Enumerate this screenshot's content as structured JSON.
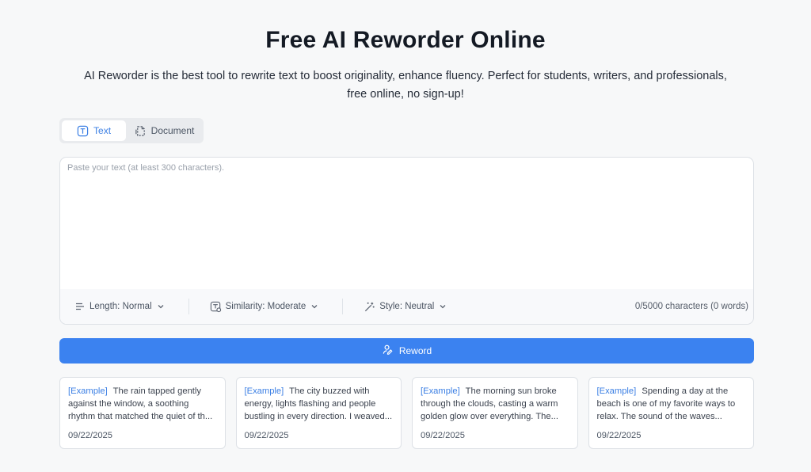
{
  "header": {
    "title": "Free AI Reworder Online",
    "subtitle": "AI Reworder is the best tool to rewrite text to boost originality, enhance fluency. Perfect for students, writers, and professionals, free online, no sign-up!"
  },
  "mode_tabs": [
    {
      "label": "Text",
      "icon": "text-icon",
      "active": true
    },
    {
      "label": "Document",
      "icon": "document-icon",
      "active": false
    }
  ],
  "editor": {
    "placeholder": "Paste your text (at least 300 characters).",
    "value": "",
    "options": {
      "length": "Length: Normal",
      "similarity": "Similarity: Moderate",
      "style": "Style: Neutral"
    },
    "counter": "0/5000 characters (0 words)"
  },
  "reword_button": {
    "label": "Reword",
    "icon": "reword-icon",
    "color": "#3b82f0"
  },
  "accent_color": "#3b7fe4",
  "examples": [
    {
      "tag": "[Example]",
      "text": "The rain tapped gently against the window, a soothing rhythm that matched the quiet of th...",
      "date": "09/22/2025"
    },
    {
      "tag": "[Example]",
      "text": "The city buzzed with energy, lights flashing and people bustling in every direction. I weaved...",
      "date": "09/22/2025"
    },
    {
      "tag": "[Example]",
      "text": "The morning sun broke through the clouds, casting a warm golden glow over everything. The...",
      "date": "09/22/2025"
    },
    {
      "tag": "[Example]",
      "text": "Spending a day at the beach is one of my favorite ways to relax. The sound of the waves...",
      "date": "09/22/2025"
    }
  ]
}
